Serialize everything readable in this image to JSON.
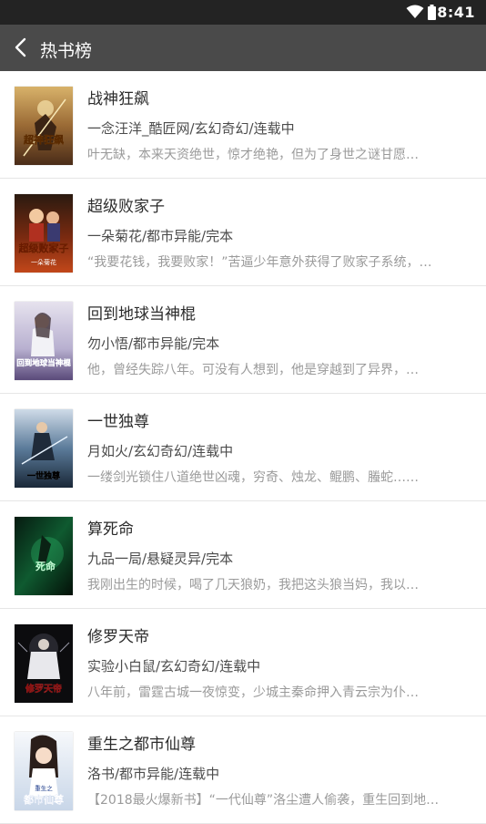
{
  "status_bar": {
    "time": "8:41"
  },
  "app_bar": {
    "title": "热书榜"
  },
  "books": [
    {
      "title": "战神狂飙",
      "meta": "一念汪洋_酷匠网/玄幻奇幻/连载中",
      "desc": "叶无缺，本来天资绝世，惊才绝艳，但为了身世之谜甘愿…"
    },
    {
      "title": "超级败家子",
      "meta": "一朵菊花/都市异能/完本",
      "desc": "“我要花钱，我要败家！”苦逼少年意外获得了败家子系统，…"
    },
    {
      "title": "回到地球当神棍",
      "meta": "勿小悟/都市异能/完本",
      "desc": "他，曾经失踪八年。可没有人想到，他是穿越到了异界，…"
    },
    {
      "title": "一世独尊",
      "meta": "月如火/玄幻奇幻/连载中",
      "desc": "一缕剑光锁住八道绝世凶魂，穷奇、烛龙、鲲鹏、螣蛇……"
    },
    {
      "title": "算死命",
      "meta": "九品一局/悬疑灵异/完本",
      "desc": "我刚出生的时候，喝了几天狼奶，我把这头狼当妈，我以…"
    },
    {
      "title": "修罗天帝",
      "meta": "实验小白鼠/玄幻奇幻/连载中",
      "desc": "八年前，雷霆古城一夜惊变，少城主秦命押入青云宗为仆…"
    },
    {
      "title": "重生之都市仙尊",
      "meta": "洛书/都市异能/连载中",
      "desc": "【2018最火爆新书】“一代仙尊”洛尘遭人偷袭，重生回到地…"
    }
  ],
  "covers": [
    {
      "art": "超神狂飙"
    },
    {
      "art": "超级败家子",
      "sub": "一朵菊花"
    },
    {
      "art": "回到地球当神棍"
    },
    {
      "art": "一世独尊"
    },
    {
      "art": "死命"
    },
    {
      "art": "修罗天帝"
    },
    {
      "art": "都市仙尊",
      "sub": "重生之"
    }
  ],
  "icons": {
    "back": "chevron-left-icon",
    "wifi": "wifi-icon",
    "battery": "battery-icon"
  }
}
